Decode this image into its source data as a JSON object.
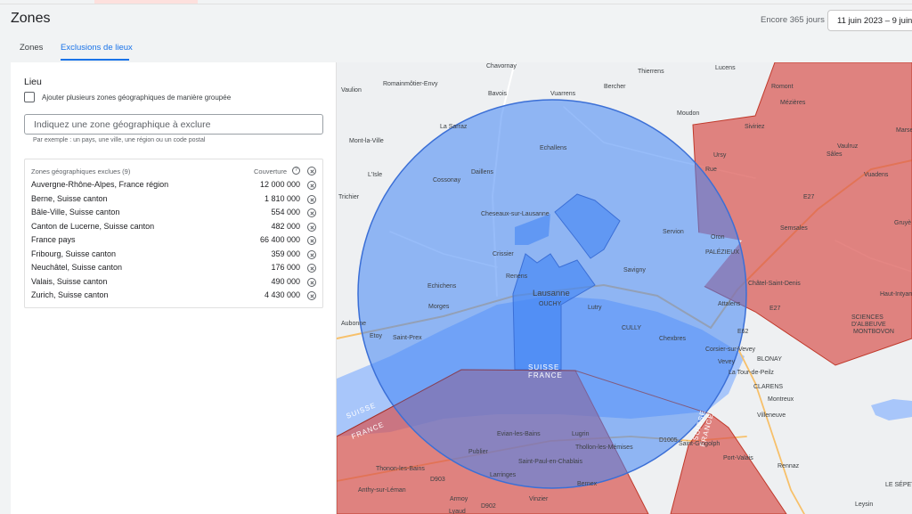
{
  "header": {
    "title": "Zones",
    "remaining": "Encore 365 jours",
    "date_range": "11 juin 2023 – 9 juin"
  },
  "tabs": [
    {
      "label": "Zones",
      "active": false
    },
    {
      "label": "Exclusions de lieux",
      "active": true
    }
  ],
  "panel": {
    "section_title": "Lieu",
    "bulk_checkbox_label": "Ajouter plusieurs zones géographiques de manière groupée",
    "bulk_checkbox_checked": false,
    "search_placeholder": "Indiquez une zone géographique à exclure",
    "search_value": "",
    "helper_text": "Par exemple : un pays, une ville, une région ou un code postal",
    "table": {
      "header_name": "Zones géographiques exclues (9)",
      "header_coverage": "Couverture",
      "rows": [
        {
          "name": "Auvergne-Rhône-Alpes, France région",
          "coverage": "12 000 000"
        },
        {
          "name": "Berne, Suisse canton",
          "coverage": "1 810 000"
        },
        {
          "name": "Bâle-Ville, Suisse canton",
          "coverage": "554 000"
        },
        {
          "name": "Canton de Lucerne, Suisse canton",
          "coverage": "482 000"
        },
        {
          "name": "France pays",
          "coverage": "66 400 000"
        },
        {
          "name": "Fribourg, Suisse canton",
          "coverage": "359 000"
        },
        {
          "name": "Neuchâtel, Suisse canton",
          "coverage": "176 000"
        },
        {
          "name": "Valais, Suisse canton",
          "coverage": "490 000"
        },
        {
          "name": "Zurich, Suisse canton",
          "coverage": "4 430 000"
        }
      ]
    }
  },
  "map": {
    "colors": {
      "target": "#4285f4",
      "excluded": "#d9534f",
      "lake": "#a8c6fa",
      "land": "#eef0f2"
    },
    "places": [
      "Chavornay",
      "Thierrens",
      "Lucens",
      "Vaulion",
      "Romainmôtier-Envy",
      "Bavois",
      "Vuarrens",
      "Bercher",
      "Moudon",
      "Romont",
      "Mézières",
      "La Sarraz",
      "Siviriez",
      "Mont-la-Ville",
      "Echallens",
      "Ursy",
      "Sâles",
      "Vaulruz",
      "Vuadens",
      "L'Isle",
      "Daillens",
      "Rue",
      "Cossonay",
      "Marsens",
      "Gruyè",
      "Cheseaux-sur-Lausanne",
      "Servion",
      "Oron",
      "Semsales",
      "Châtel-Saint-Denis",
      "Crissier",
      "Savigny",
      "Echichens",
      "Renens",
      "Lausanne",
      "Haut-Intyamon",
      "Morges",
      "Ouchy",
      "Lutry",
      "Aubonne",
      "Cully",
      "Attalens",
      "Etoy",
      "Saint-Prex",
      "Chexbres",
      "Corsier-sur-Vevey",
      "Vevey",
      "Blonay",
      "La Tour-de-Peilz",
      "Clarens",
      "Montreux",
      "Evian-les-Bains",
      "Lugrin",
      "Thollon-les-Mémises",
      "Publier",
      "Saint-Paul-en-Chablais",
      "Thonon-les-Bains",
      "Larringes",
      "Saint-Gingolph",
      "Port-Valais",
      "Villeneuve",
      "Bernex",
      "Anthy-sur-Léman",
      "Armoy",
      "Vinzier",
      "Rennaz",
      "Lyaud",
      "Leysin",
      "Le Sépey",
      "Montbovon",
      "Trichier"
    ],
    "district_labels": [
      "Palézieux",
      "Sciences d'Albeuve",
      "Albeuve"
    ],
    "border_labels": [
      "SUISSE",
      "FRANCE"
    ],
    "road_labels": [
      "E27",
      "E62",
      "D1005",
      "D902",
      "D903"
    ]
  }
}
